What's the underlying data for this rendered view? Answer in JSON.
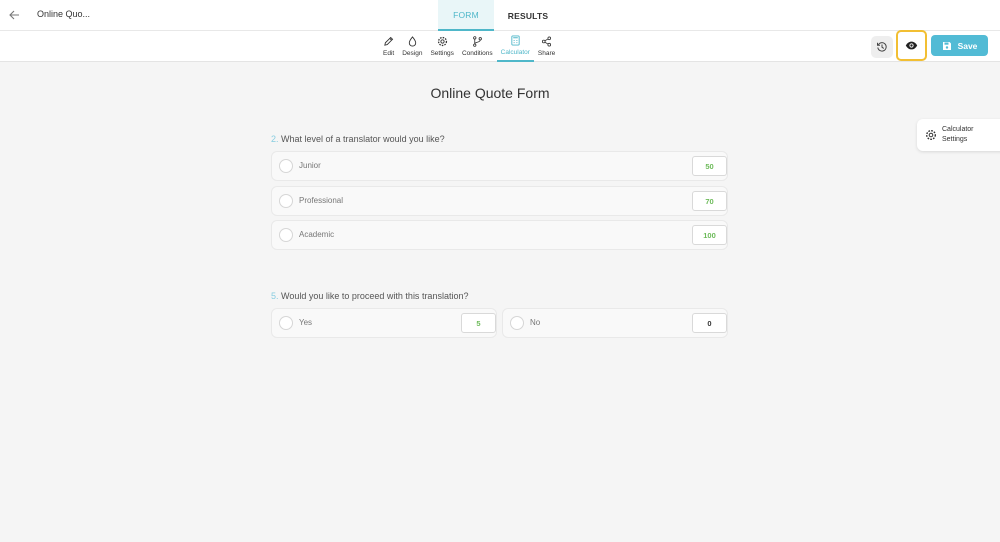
{
  "header": {
    "form_name": "Online Quo...",
    "tabs": [
      {
        "label": "FORM"
      },
      {
        "label": "RESULTS"
      }
    ]
  },
  "toolbar": {
    "tools": [
      {
        "label": "Edit",
        "icon": "pencil-icon"
      },
      {
        "label": "Design",
        "icon": "droplet-icon"
      },
      {
        "label": "Settings",
        "icon": "gear-icon"
      },
      {
        "label": "Conditions",
        "icon": "branch-icon"
      },
      {
        "label": "Calculator",
        "icon": "calculator-icon"
      },
      {
        "label": "Share",
        "icon": "share-icon"
      }
    ],
    "active_tool": "Calculator",
    "save_label": "Save"
  },
  "form": {
    "title": "Online Quote Form",
    "questions": [
      {
        "number": "2.",
        "text": "What level of a translator would you like?",
        "options": [
          {
            "label": "Junior",
            "score": "50"
          },
          {
            "label": "Professional",
            "score": "70"
          },
          {
            "label": "Academic",
            "score": "100"
          }
        ]
      },
      {
        "number": "5.",
        "text": "Would you like to proceed with this translation?",
        "options": [
          {
            "label": "Yes",
            "score": "5"
          },
          {
            "label": "No",
            "score": "0"
          }
        ]
      }
    ]
  },
  "side_panel": {
    "calculator_settings_label": "Calculator Settings"
  },
  "colors": {
    "accent": "#4fb7c9",
    "save": "#52bbd5",
    "score_green": "#6dbb5a",
    "highlight": "#f2bf33"
  }
}
